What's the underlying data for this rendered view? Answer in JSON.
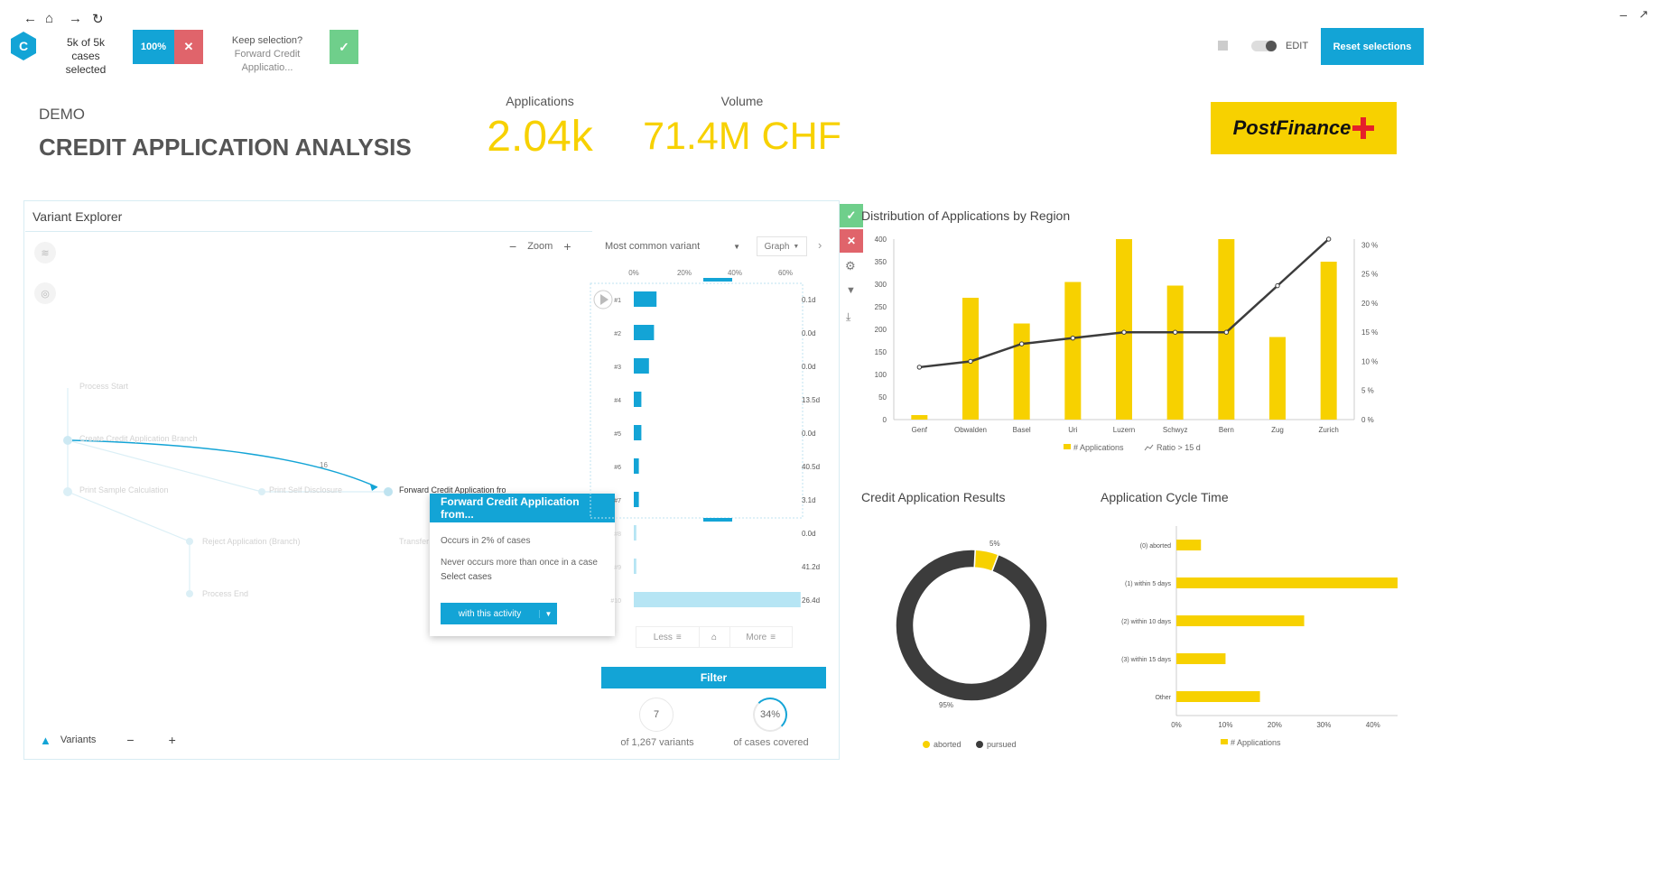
{
  "colors": {
    "accent": "#13a4d6",
    "yellow": "#f7d100",
    "red": "#e0646b",
    "green": "#6fcf8b",
    "dark": "#3c3c3c"
  },
  "nav": {
    "back_icon": "arrow-left-icon",
    "home_icon": "home-icon",
    "forward_icon": "arrow-right-icon",
    "refresh_icon": "refresh-icon"
  },
  "selection_bar": {
    "logo_letter": "C",
    "count_line1": "5k of 5k",
    "count_line2": "cases selected",
    "percent": "100%",
    "keep_title": "Keep selection?",
    "keep_subtitle": "Forward Credit Applicatio..."
  },
  "top_right": {
    "edit_label": "EDIT",
    "reset_label": "Reset selections"
  },
  "header": {
    "demo": "DEMO",
    "title": "CREDIT APPLICATION ANALYSIS",
    "kpis": [
      {
        "label": "Applications",
        "value": "2.04k"
      },
      {
        "label": "Volume",
        "value": "71.4M CHF"
      }
    ],
    "brand": "PostFinance"
  },
  "variant_explorer": {
    "title": "Variant Explorer",
    "zoom_label": "Zoom",
    "node_label": "Forward Credit Application from Branch",
    "edge_label": "16",
    "popup": {
      "title": "Forward Credit Application from...",
      "line1": "Occurs in 2% of cases",
      "line2": "Never occurs more than once in a case",
      "line3": "Select cases",
      "button": "with this activity"
    },
    "faded_nodes": [
      "Process Start",
      "Create Credit Application Branch",
      "Print Sample Calculation",
      "Print Self Disclosure",
      "Reject Application (Branch)",
      "Process End",
      "Transfer"
    ],
    "variants_label": "Variants",
    "dropdown": "Most common variant",
    "graph_label": "Graph",
    "axis_ticks": [
      "0%",
      "20%",
      "40%",
      "60%"
    ],
    "rows": [
      {
        "id": "#1",
        "pct": 9,
        "dur": "0.1d"
      },
      {
        "id": "#2",
        "pct": 8,
        "dur": "0.0d"
      },
      {
        "id": "#3",
        "pct": 6,
        "dur": "0.0d"
      },
      {
        "id": "#4",
        "pct": 3,
        "dur": "13.5d"
      },
      {
        "id": "#5",
        "pct": 3,
        "dur": "0.0d"
      },
      {
        "id": "#6",
        "pct": 2,
        "dur": "40.5d"
      },
      {
        "id": "#7",
        "pct": 2,
        "dur": "3.1d"
      },
      {
        "id": "#8",
        "pct": 1,
        "dur": "0.0d"
      },
      {
        "id": "#9",
        "pct": 1,
        "dur": "41.2d"
      },
      {
        "id": "#10",
        "pct": 66,
        "dur": "26.4d"
      }
    ],
    "less_label": "Less",
    "more_label": "More",
    "filter_label": "Filter",
    "variants_count": "7",
    "variants_text": "of 1,267 variants",
    "coverage": "34%",
    "coverage_text": "of cases covered"
  },
  "charts_meta": {
    "region_title": "Distribution of Applications by Region",
    "results_title": "Credit Application Results",
    "cycle_title": "Application Cycle Time"
  },
  "chart_data": [
    {
      "type": "bar",
      "title": "Distribution of Applications by Region",
      "categories": [
        "Genf",
        "Obwalden",
        "Basel",
        "Uri",
        "Luzern",
        "Schwyz",
        "Bern",
        "Zug",
        "Zurich"
      ],
      "series": [
        {
          "name": "# Applications",
          "values": [
            10,
            270,
            213,
            305,
            400,
            297,
            400,
            183,
            350
          ]
        },
        {
          "name": "Ratio > 15 d",
          "values": [
            9,
            10,
            13,
            14,
            15,
            15,
            15,
            23,
            31
          ]
        }
      ],
      "y_ticks": [
        "0",
        "50",
        "100",
        "150",
        "200",
        "250",
        "300",
        "350",
        "400"
      ],
      "y2_ticks": [
        "0 %",
        "5 %",
        "10 %",
        "15 %",
        "20 %",
        "25 %",
        "30 %"
      ],
      "ylim": [
        0,
        400
      ],
      "y2lim": [
        0,
        31
      ],
      "legend": "bottom"
    },
    {
      "type": "pie",
      "title": "Credit Application Results",
      "labels": [
        "aborted",
        "pursued"
      ],
      "values": [
        5,
        95
      ],
      "slice_labels": [
        "5%",
        "95%"
      ],
      "legend": "bottom"
    },
    {
      "type": "bar",
      "title": "Application Cycle Time",
      "orientation": "horizontal",
      "categories": [
        "(0) aborted",
        "(1) within 5 days",
        "(2) within 10 days",
        "(3) within 15 days",
        "Other"
      ],
      "series": [
        {
          "name": "# Applications",
          "values": [
            5,
            45,
            26,
            10,
            17
          ]
        }
      ],
      "x_ticks": [
        "0%",
        "10%",
        "20%",
        "30%",
        "40%"
      ],
      "xlim": [
        0,
        45
      ],
      "legend": "bottom"
    }
  ]
}
